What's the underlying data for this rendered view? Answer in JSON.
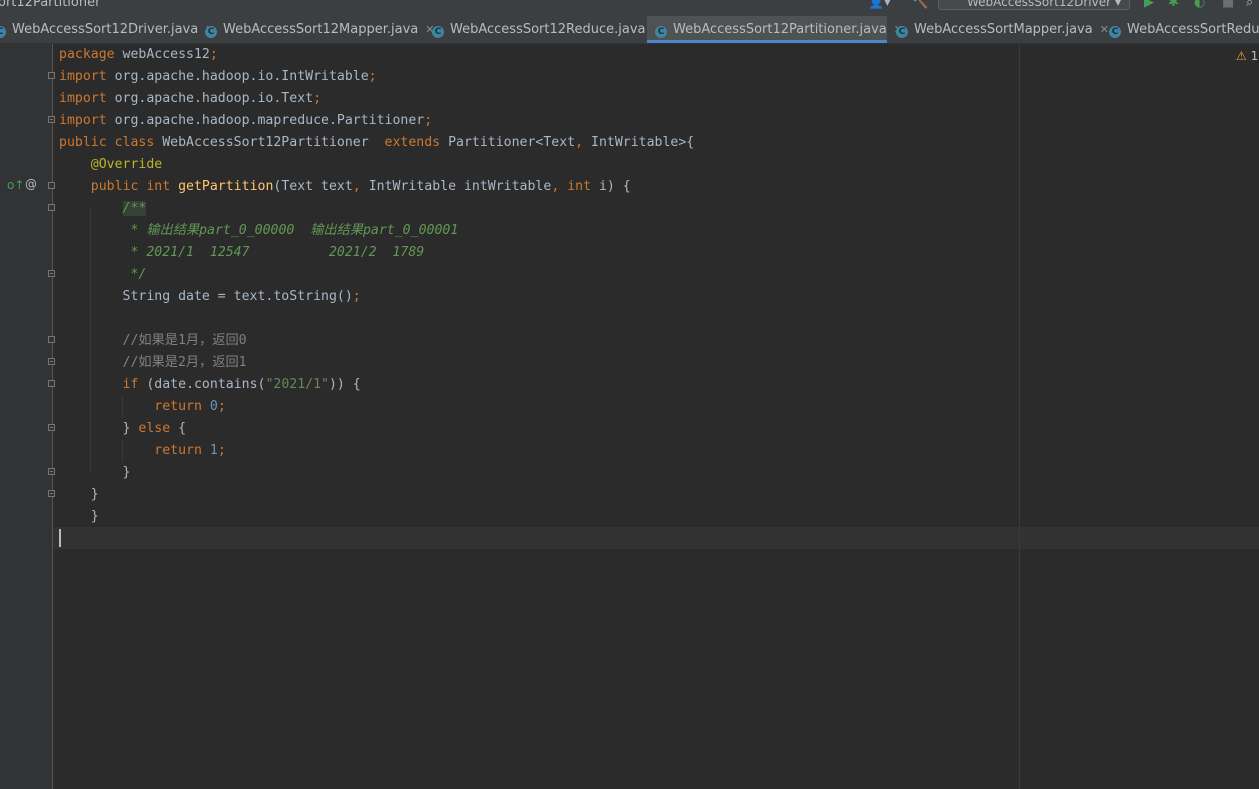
{
  "title_bar": {
    "breadcrumb": "ort12Partitioner",
    "run_config": "WebAccessSort12Driver"
  },
  "tabs": [
    {
      "label": "WebAccessSort12Driver.java"
    },
    {
      "label": "WebAccessSort12Mapper.java"
    },
    {
      "label": "WebAccessSort12Reduce.java"
    },
    {
      "label": "WebAccessSort12Partitioner.java",
      "active": true
    },
    {
      "label": "WebAccessSortMapper.java"
    },
    {
      "label": "WebAccessSortReduce"
    }
  ],
  "editor": {
    "warning_count": "1",
    "gutter_icons": {
      "implements": "o↑",
      "override": "@"
    },
    "code_lines": [
      [
        {
          "t": "package ",
          "c": "kw"
        },
        {
          "t": "webAccess12",
          "c": ""
        },
        {
          "t": ";",
          "c": "kw"
        }
      ],
      [
        {
          "t": "import ",
          "c": "kw"
        },
        {
          "t": "org.apache.hadoop.io.IntWritable",
          "c": ""
        },
        {
          "t": ";",
          "c": "kw"
        }
      ],
      [
        {
          "t": "import ",
          "c": "kw"
        },
        {
          "t": "org.apache.hadoop.io.Text",
          "c": ""
        },
        {
          "t": ";",
          "c": "kw"
        }
      ],
      [
        {
          "t": "import ",
          "c": "kw"
        },
        {
          "t": "org.apache.hadoop.mapreduce.Partitioner",
          "c": ""
        },
        {
          "t": ";",
          "c": "kw"
        }
      ],
      [
        {
          "t": "public class ",
          "c": "kw"
        },
        {
          "t": "WebAccessSort12Partitioner  ",
          "c": ""
        },
        {
          "t": "extends ",
          "c": "kw"
        },
        {
          "t": "Partitioner<Text",
          "c": ""
        },
        {
          "t": ", ",
          "c": "kw"
        },
        {
          "t": "IntWritable>{",
          "c": ""
        }
      ],
      [
        {
          "t": "    ",
          "c": ""
        },
        {
          "t": "@Override",
          "c": "ann"
        }
      ],
      [
        {
          "t": "    ",
          "c": ""
        },
        {
          "t": "public int ",
          "c": "kw"
        },
        {
          "t": "getPartition",
          "c": "fn"
        },
        {
          "t": "(Text text",
          "c": ""
        },
        {
          "t": ", ",
          "c": "kw"
        },
        {
          "t": "IntWritable intWritable",
          "c": ""
        },
        {
          "t": ", ",
          "c": "kw"
        },
        {
          "t": "int ",
          "c": "kw"
        },
        {
          "t": "i) {",
          "c": ""
        }
      ],
      [
        {
          "t": "        ",
          "c": ""
        },
        {
          "t": "/**",
          "c": "doc dochl"
        }
      ],
      [
        {
          "t": "         * 输出结果part_0_00000  输出结果part_0_00001",
          "c": "doc"
        }
      ],
      [
        {
          "t": "         * 2021/1  12547          2021/2  1789",
          "c": "doc"
        }
      ],
      [
        {
          "t": "         */",
          "c": "doc"
        }
      ],
      [
        {
          "t": "        String date = text.toString()",
          "c": ""
        },
        {
          "t": ";",
          "c": "kw"
        }
      ],
      [],
      [
        {
          "t": "        ",
          "c": ""
        },
        {
          "t": "//如果是1月，返回0",
          "c": "cm"
        }
      ],
      [
        {
          "t": "        ",
          "c": ""
        },
        {
          "t": "//如果是2月，返回1",
          "c": "cm"
        }
      ],
      [
        {
          "t": "        ",
          "c": ""
        },
        {
          "t": "if ",
          "c": "kw"
        },
        {
          "t": "(date.contains(",
          "c": ""
        },
        {
          "t": "\"2021/1\"",
          "c": "str"
        },
        {
          "t": ")) {",
          "c": ""
        }
      ],
      [
        {
          "t": "            ",
          "c": ""
        },
        {
          "t": "return ",
          "c": "kw"
        },
        {
          "t": "0",
          "c": "num"
        },
        {
          "t": ";",
          "c": "kw"
        }
      ],
      [
        {
          "t": "        } ",
          "c": ""
        },
        {
          "t": "else ",
          "c": "kw"
        },
        {
          "t": "{",
          "c": ""
        }
      ],
      [
        {
          "t": "            ",
          "c": ""
        },
        {
          "t": "return ",
          "c": "kw"
        },
        {
          "t": "1",
          "c": "num"
        },
        {
          "t": ";",
          "c": "kw"
        }
      ],
      [
        {
          "t": "        }",
          "c": ""
        }
      ],
      [
        {
          "t": "    }",
          "c": ""
        }
      ],
      [
        {
          "t": "    }",
          "c": ""
        }
      ],
      []
    ]
  }
}
